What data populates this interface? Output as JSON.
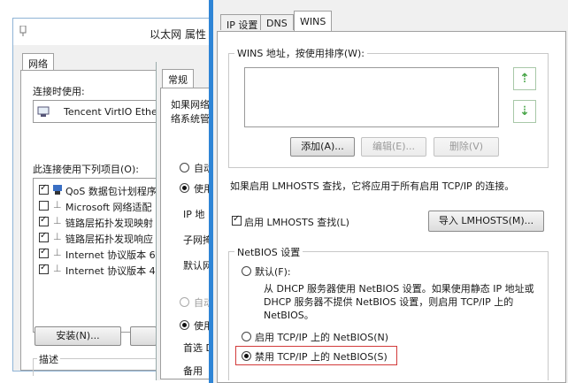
{
  "window1": {
    "title": "以太网 属性",
    "tab_network": "网络",
    "connect_using_label": "连接时使用:",
    "adapter_name": "Tencent VirtIO Ethe",
    "items_label": "此连接使用下列项目(O):",
    "items": [
      {
        "label": "QoS 数据包计划程序",
        "checked": true
      },
      {
        "label": "Microsoft 网络适配",
        "checked": false
      },
      {
        "label": "链路层拓扑发现映射",
        "checked": true
      },
      {
        "label": "链路层拓扑发现响应",
        "checked": true
      },
      {
        "label": "Internet 协议版本 6",
        "checked": true
      },
      {
        "label": "Internet 协议版本 4",
        "checked": true
      }
    ],
    "install_button": "安装(N)...",
    "description_label": "描述"
  },
  "window2": {
    "tab_general": "常规",
    "intro_line1": "如果网络",
    "intro_line2": "络系统管",
    "auto_ip": "自动",
    "use_ip": "使用",
    "ip_label": "IP 地",
    "subnet_label": "子网掩",
    "gateway_label": "默认网",
    "auto_dns": "自动",
    "use_dns": "使用",
    "preferred_dns": "首选 D",
    "alternate_dns": "备用"
  },
  "window3": {
    "tabs": {
      "ip": "IP 设置",
      "dns": "DNS",
      "wins": "WINS"
    },
    "wins_group_label": "WINS 地址，按使用排序(W):",
    "add_button": "添加(A)...",
    "edit_button": "编辑(E)...",
    "delete_button": "删除(V)",
    "lmhosts_note": "如果启用 LMHOSTS 查找，它将应用于所有启用 TCP/IP 的连接。",
    "lmhosts_checkbox": "启用 LMHOSTS 查找(L)",
    "import_button": "导入 LMHOSTS(M)...",
    "netbios_group": "NetBIOS 设置",
    "default_option": "默认(F):",
    "default_desc_1": "从 DHCP 服务器使用 NetBIOS 设置。如果使用静态 IP 地址或",
    "default_desc_2": "DHCP 服务器不提供 NetBIOS 设置，则启用 TCP/IP 上的",
    "default_desc_3": "NetBIOS。",
    "enable_option": "启用 TCP/IP 上的 NetBIOS(N)",
    "disable_option": "禁用 TCP/IP 上的 NetBIOS(S)"
  },
  "colors": {
    "accent_blue": "#2f85d6",
    "highlight_red": "#d23a3a",
    "arrow_green": "#4aa64a"
  }
}
